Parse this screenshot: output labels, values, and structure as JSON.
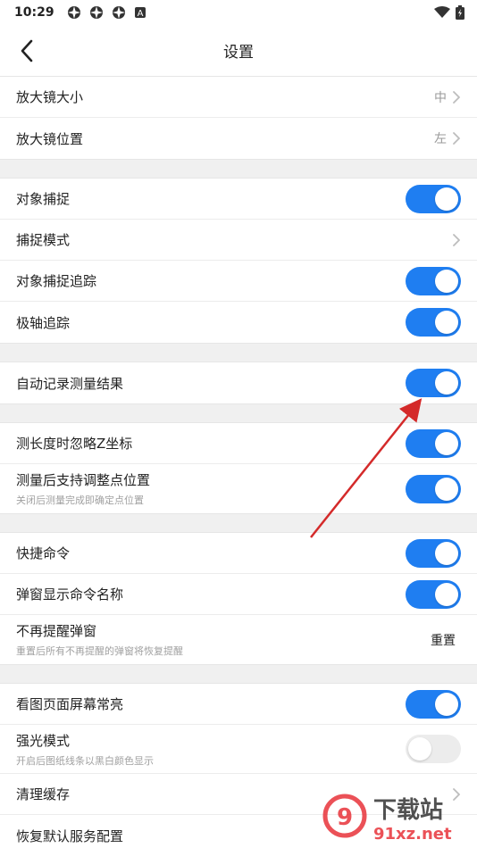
{
  "status_bar": {
    "time": "10:29",
    "left_icons": [
      "app-icon",
      "app-icon",
      "app-icon",
      "a-icon"
    ],
    "right_icons": [
      "wifi-icon",
      "battery-icon"
    ]
  },
  "header": {
    "title": "设置"
  },
  "groups": [
    {
      "rows": [
        {
          "label": "放大镜大小",
          "value": "中",
          "chevron": true
        },
        {
          "label": "放大镜位置",
          "value": "左",
          "chevron": true
        }
      ]
    },
    {
      "rows": [
        {
          "label": "对象捕捉",
          "toggle": true
        },
        {
          "label": "捕捉模式",
          "chevron": true
        },
        {
          "label": "对象捕捉追踪",
          "toggle": true
        },
        {
          "label": "极轴追踪",
          "toggle": true
        }
      ]
    },
    {
      "rows": [
        {
          "label": "自动记录测量结果",
          "toggle": true
        }
      ]
    },
    {
      "rows": [
        {
          "label": "测长度时忽略Z坐标",
          "toggle": true
        },
        {
          "label": "测量后支持调整点位置",
          "sub": "关闭后测量完成即确定点位置",
          "toggle": true
        }
      ]
    },
    {
      "rows": [
        {
          "label": "快捷命令",
          "toggle": true
        },
        {
          "label": "弹窗显示命令名称",
          "toggle": true
        },
        {
          "label": "不再提醒弹窗",
          "sub": "重置后所有不再提醒的弹窗将恢复提醒",
          "action": "重置"
        }
      ]
    },
    {
      "rows": [
        {
          "label": "看图页面屏幕常亮",
          "toggle": true
        },
        {
          "label": "强光模式",
          "sub": "开启后图纸线条以黑白颜色显示",
          "toggle": false
        },
        {
          "label": "清理缓存",
          "chevron": true
        },
        {
          "label": "恢复默认服务配置"
        }
      ]
    }
  ],
  "watermark": {
    "text": "下载站",
    "domain": "91xz.net"
  },
  "colors": {
    "accent": "#1f7ef1",
    "arrow": "#d42a2a",
    "watermark": "#e8333a"
  }
}
